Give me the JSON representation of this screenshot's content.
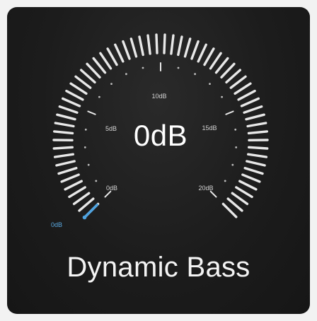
{
  "control": {
    "title": "Dynamic Bass",
    "value_label": "0dB",
    "level_fraction": 0
  },
  "dial": {
    "min_label": "0dB",
    "scale_labels": [
      "0dB",
      "5dB",
      "10dB",
      "15dB",
      "20dB"
    ]
  },
  "colors": {
    "background": "#1c1c1c",
    "tick": "#e8e8e8",
    "minor_dot": "#bdbdbd",
    "accent": "#4fa3e0",
    "text": "#ffffff"
  }
}
